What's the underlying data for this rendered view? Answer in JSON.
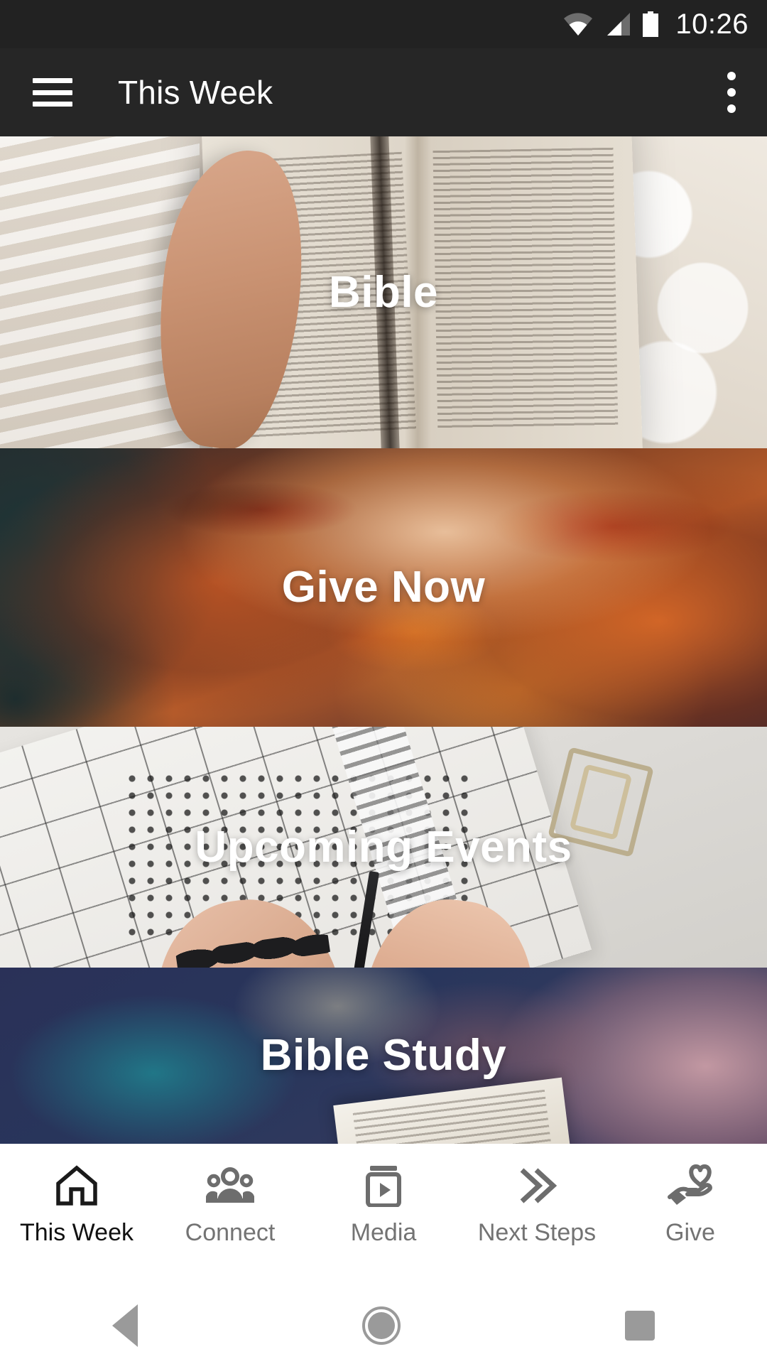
{
  "status_bar": {
    "time": "10:26",
    "icons": [
      "wifi-icon",
      "cellular-signal-icon",
      "battery-icon"
    ]
  },
  "app_bar": {
    "menu_icon": "hamburger-menu-icon",
    "title": "This Week",
    "overflow_icon": "overflow-menu-icon",
    "background_color": "#262626",
    "text_color": "#ffffff"
  },
  "cards": [
    {
      "label": "Bible",
      "image": "open-bible-on-white-bedding"
    },
    {
      "label": "Give Now",
      "image": "fiery-orange-sunset-clouds"
    },
    {
      "label": "Upcoming Events",
      "image": "hands-writing-in-paper-planner-calendar"
    },
    {
      "label": "Bible Study",
      "image": "navy-teal-bokeh-with-open-book"
    }
  ],
  "tab_bar": {
    "active_index": 0,
    "active_color": "#111111",
    "inactive_color": "#737373",
    "items": [
      {
        "label": "This Week",
        "icon": "home-icon"
      },
      {
        "label": "Connect",
        "icon": "people-group-icon"
      },
      {
        "label": "Media",
        "icon": "media-player-icon"
      },
      {
        "label": "Next Steps",
        "icon": "double-chevron-right-icon"
      },
      {
        "label": "Give",
        "icon": "hand-holding-heart-icon"
      }
    ]
  },
  "system_nav": {
    "back": "back-triangle-icon",
    "home": "home-circle-icon",
    "recents": "recents-square-icon"
  }
}
